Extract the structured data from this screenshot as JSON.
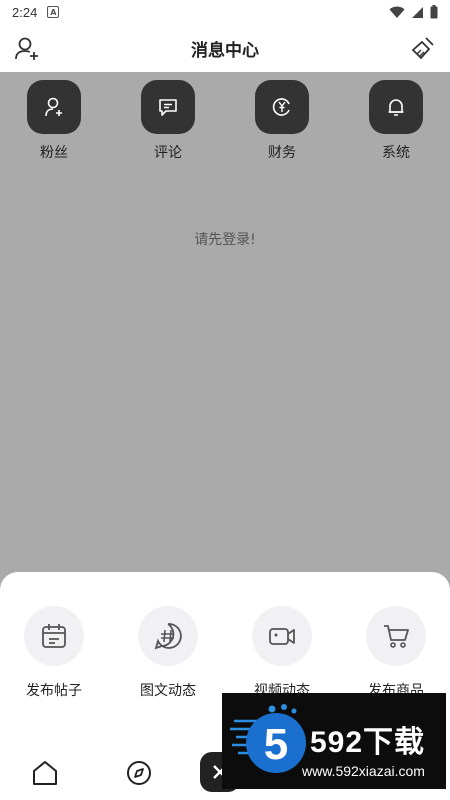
{
  "status_bar": {
    "time": "2:24",
    "app_badge": "A"
  },
  "header": {
    "title": "消息中心"
  },
  "categories": [
    {
      "label": "粉丝",
      "icon": "user-add-icon"
    },
    {
      "label": "评论",
      "icon": "comment-icon"
    },
    {
      "label": "财务",
      "icon": "yuan-icon"
    },
    {
      "label": "系统",
      "icon": "bell-icon"
    }
  ],
  "login_hint": "请先登录!",
  "publish_actions": [
    {
      "label": "发布帖子",
      "icon": "calendar-post-icon"
    },
    {
      "label": "图文动态",
      "icon": "hashtag-icon"
    },
    {
      "label": "视频动态",
      "icon": "video-camera-icon"
    },
    {
      "label": "发布商品",
      "icon": "shopping-cart-icon"
    }
  ],
  "bottom_nav": [
    {
      "icon": "home-icon"
    },
    {
      "icon": "compass-icon"
    },
    {
      "icon": "close-icon"
    }
  ],
  "watermark": {
    "brand": "592下载",
    "url": "www.592xiazai.com"
  },
  "colors": {
    "overlay": "#aaaaaa",
    "icon_bg": "#333333",
    "action_bg": "#f1f1f4",
    "watermark_accent": "#2a8fe0"
  }
}
